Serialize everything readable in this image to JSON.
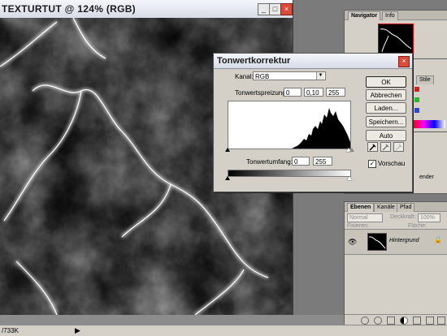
{
  "document": {
    "title": "TEXTURTUT @ 124% (RGB)",
    "minimize": "_",
    "maximize": "□",
    "close": "×"
  },
  "navigator": {
    "tabs": [
      {
        "label": "Navigator",
        "active": true
      },
      {
        "label": "Info",
        "active": false
      }
    ]
  },
  "color_panel": {
    "tab_style": "Stile",
    "slider_colors": [
      "#d22121",
      "#2db52d",
      "#2f45d0"
    ]
  },
  "style_panel": {
    "label": "ender"
  },
  "layers": {
    "tabs": [
      {
        "label": "Ebenen",
        "active": true
      },
      {
        "label": "Kanäle",
        "active": false
      },
      {
        "label": "Pfad",
        "active": false
      }
    ],
    "blend_mode": "Normal",
    "opacity_label": "Deckkraft:",
    "opacity_value": "100%",
    "lock_label": "Fixieren:",
    "fill_label": "Fläche:",
    "layer_name": "Hintergrund",
    "lock_icon": "🔒"
  },
  "dialog": {
    "title": "Tonwertkorrektur",
    "channel_label": "Kanal:",
    "channel_value": "RGB",
    "input_label": "Tonwertspreizung:",
    "input_values": [
      "0",
      "0,10",
      "255"
    ],
    "output_label": "Tonwertumfang:",
    "output_values": [
      "0",
      "255"
    ],
    "buttons": {
      "ok": "OK",
      "cancel": "Abbrechen",
      "load": "Laden...",
      "save": "Speichern...",
      "auto": "Auto"
    },
    "preview_label": "Vorschau",
    "preview_checked": true,
    "close": "×"
  },
  "status": {
    "size_text": "/733K",
    "arrow": "▶"
  }
}
